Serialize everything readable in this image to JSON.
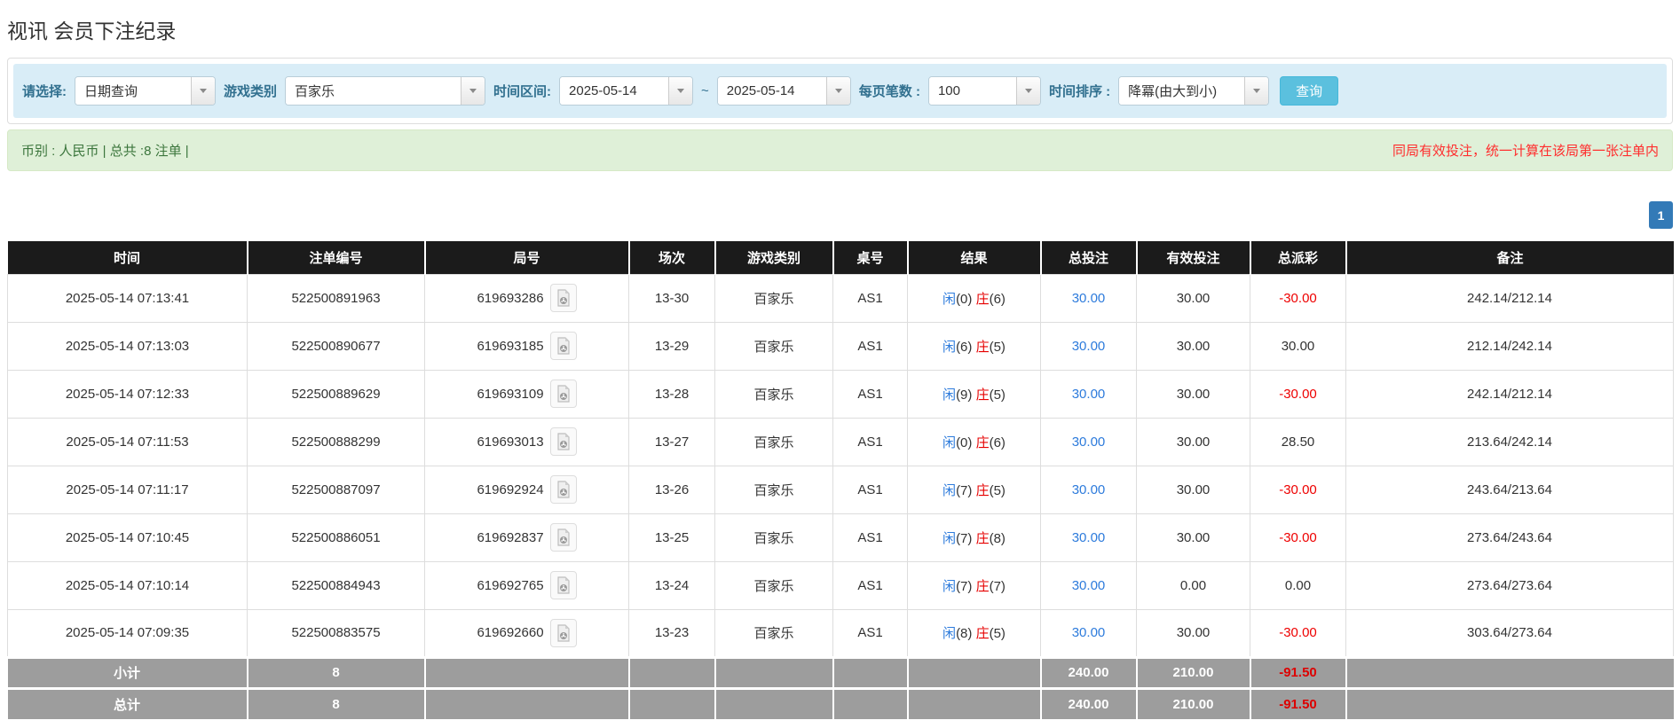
{
  "page": {
    "title": "视讯 会员下注纪录"
  },
  "filters": {
    "select_label": "请选择:",
    "select_value": "日期查询",
    "game_type_label": "游戏类别",
    "game_type_value": "百家乐",
    "date_range_label": "时间区间:",
    "date_from": "2025-05-14",
    "date_separator": "~",
    "date_to": "2025-05-14",
    "page_size_label": "每页笔数 :",
    "page_size_value": "100",
    "sort_label": "时间排序 :",
    "sort_value": "降冪(由大到小)",
    "search_button": "查询"
  },
  "summary": {
    "left_text": "币别 : 人民币 | 总共 :8 注单 |",
    "right_note": "同局有效投注，统一计算在该局第一张注单内"
  },
  "pagination": {
    "current_page": "1"
  },
  "table": {
    "headers": [
      "时间",
      "注单编号",
      "局号",
      "场次",
      "游戏类别",
      "桌号",
      "结果",
      "总投注",
      "有效投注",
      "总派彩",
      "备注"
    ],
    "rows": [
      {
        "time": "2025-05-14 07:13:41",
        "bet_id": "522500891963",
        "round_no": "619693286",
        "session": "13-30",
        "game_type": "百家乐",
        "table_no": "AS1",
        "p_label": "闲",
        "p_score": "(0)",
        "b_label": "庄",
        "b_score": "(6)",
        "total_bet": "30.00",
        "valid_bet": "30.00",
        "payout": "-30.00",
        "remark": "242.14/212.14"
      },
      {
        "time": "2025-05-14 07:13:03",
        "bet_id": "522500890677",
        "round_no": "619693185",
        "session": "13-29",
        "game_type": "百家乐",
        "table_no": "AS1",
        "p_label": "闲",
        "p_score": "(6)",
        "b_label": "庄",
        "b_score": "(5)",
        "total_bet": "30.00",
        "valid_bet": "30.00",
        "payout": "30.00",
        "remark": "212.14/242.14"
      },
      {
        "time": "2025-05-14 07:12:33",
        "bet_id": "522500889629",
        "round_no": "619693109",
        "session": "13-28",
        "game_type": "百家乐",
        "table_no": "AS1",
        "p_label": "闲",
        "p_score": "(9)",
        "b_label": "庄",
        "b_score": "(5)",
        "total_bet": "30.00",
        "valid_bet": "30.00",
        "payout": "-30.00",
        "remark": "242.14/212.14"
      },
      {
        "time": "2025-05-14 07:11:53",
        "bet_id": "522500888299",
        "round_no": "619693013",
        "session": "13-27",
        "game_type": "百家乐",
        "table_no": "AS1",
        "p_label": "闲",
        "p_score": "(0)",
        "b_label": "庄",
        "b_score": "(6)",
        "total_bet": "30.00",
        "valid_bet": "30.00",
        "payout": "28.50",
        "remark": "213.64/242.14"
      },
      {
        "time": "2025-05-14 07:11:17",
        "bet_id": "522500887097",
        "round_no": "619692924",
        "session": "13-26",
        "game_type": "百家乐",
        "table_no": "AS1",
        "p_label": "闲",
        "p_score": "(7)",
        "b_label": "庄",
        "b_score": "(5)",
        "total_bet": "30.00",
        "valid_bet": "30.00",
        "payout": "-30.00",
        "remark": "243.64/213.64"
      },
      {
        "time": "2025-05-14 07:10:45",
        "bet_id": "522500886051",
        "round_no": "619692837",
        "session": "13-25",
        "game_type": "百家乐",
        "table_no": "AS1",
        "p_label": "闲",
        "p_score": "(7)",
        "b_label": "庄",
        "b_score": "(8)",
        "total_bet": "30.00",
        "valid_bet": "30.00",
        "payout": "-30.00",
        "remark": "273.64/243.64"
      },
      {
        "time": "2025-05-14 07:10:14",
        "bet_id": "522500884943",
        "round_no": "619692765",
        "session": "13-24",
        "game_type": "百家乐",
        "table_no": "AS1",
        "p_label": "闲",
        "p_score": "(7)",
        "b_label": "庄",
        "b_score": "(7)",
        "total_bet": "30.00",
        "valid_bet": "0.00",
        "payout": "0.00",
        "remark": "273.64/273.64"
      },
      {
        "time": "2025-05-14 07:09:35",
        "bet_id": "522500883575",
        "round_no": "619692660",
        "session": "13-23",
        "game_type": "百家乐",
        "table_no": "AS1",
        "p_label": "闲",
        "p_score": "(8)",
        "b_label": "庄",
        "b_score": "(5)",
        "total_bet": "30.00",
        "valid_bet": "30.00",
        "payout": "-30.00",
        "remark": "303.64/273.64"
      }
    ],
    "subtotal": {
      "label": "小计",
      "count": "8",
      "total_bet": "240.00",
      "valid_bet": "210.00",
      "payout": "-91.50"
    },
    "total": {
      "label": "总计",
      "count": "8",
      "total_bet": "240.00",
      "valid_bet": "210.00",
      "payout": "-91.50"
    }
  },
  "colors": {
    "filter_bar_bg": "#d9edf7",
    "filter_label": "#31708f",
    "search_button_bg": "#5bc0de",
    "alert_bg": "#dff0d8",
    "alert_text": "#3c763d",
    "alert_note_red": "#ff2d2d",
    "pagination_active_bg": "#337ab7",
    "table_header_bg": "#1b1b1b",
    "summary_row_bg": "#9d9d9d",
    "link_blue": "#2d7bdc",
    "banker_red": "#e60000",
    "negative_red": "#ee0000"
  }
}
